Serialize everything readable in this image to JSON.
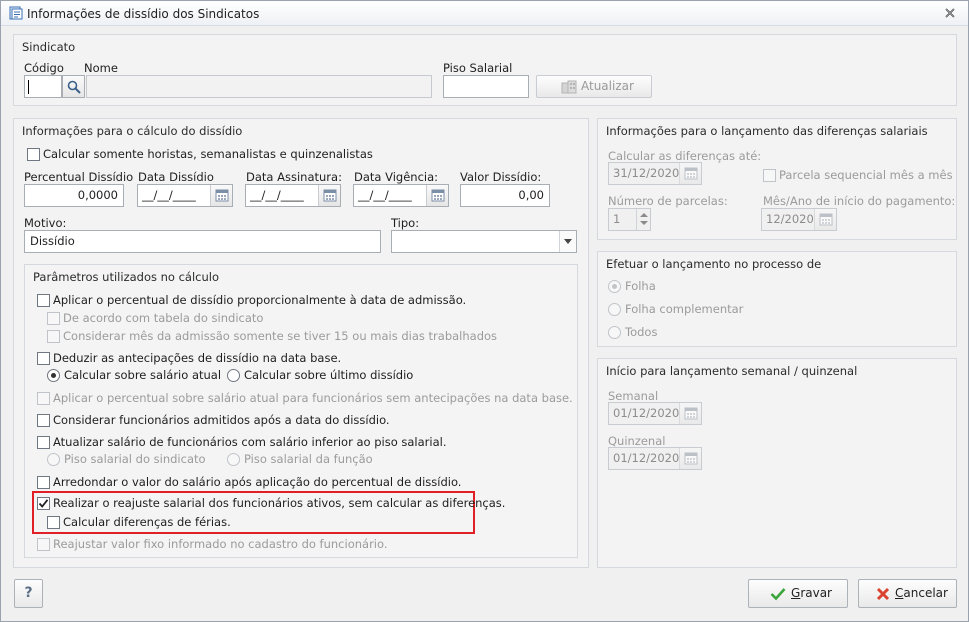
{
  "window": {
    "title": "Informações de dissídio dos Sindicatos"
  },
  "sindicato": {
    "group_title": "Sindicato",
    "codigo_label": "Código",
    "nome_label": "Nome",
    "piso_label": "Piso Salarial",
    "atualizar_label": "Atualizar"
  },
  "calculo": {
    "group_title": "Informações para o cálculo do dissídio",
    "horistas_label": "Calcular somente horistas, semanalistas e quinzenalistas",
    "percentual_label": "Percentual Dissídio",
    "percentual_value": "0,0000",
    "data_dissidio_label": "Data Dissídio",
    "data_dissidio_value": "__/__/____",
    "data_assinatura_label": "Data Assinatura:",
    "data_assinatura_value": "__/__/____",
    "data_vigencia_label": "Data Vigência:",
    "data_vigencia_value": "__/__/____",
    "valor_label": "Valor Dissídio:",
    "valor_value": "0,00",
    "motivo_label": "Motivo:",
    "motivo_value": "Dissídio",
    "tipo_label": "Tipo:",
    "tipo_value": ""
  },
  "parametros": {
    "group_title": "Parâmetros utilizados no cálculo",
    "p1": "Aplicar o percentual de dissídio proporcionalmente à data de admissão.",
    "p1a": "De acordo com tabela do sindicato",
    "p1b": "Considerar mês da admissão somente se tiver 15 ou mais dias trabalhados",
    "p2": "Deduzir as antecipações de dissídio na data base.",
    "p2_radio1": "Calcular sobre salário atual",
    "p2_radio2": "Calcular sobre último dissídio",
    "p3": "Aplicar o percentual sobre salário atual para funcionários sem antecipações na data base.",
    "p4": "Considerar funcionários admitidos após a data do dissídio.",
    "p5": "Atualizar salário de funcionários com salário inferior ao piso salarial.",
    "p5_radio1": "Piso salarial do sindicato",
    "p5_radio2": "Piso salarial da função",
    "p6": "Arredondar o valor do salário após aplicação do percentual de dissídio.",
    "p7": "Realizar o reajuste salarial dos funcionários ativos, sem calcular as diferenças.",
    "p7a": "Calcular diferenças de férias.",
    "p8": "Reajustar valor fixo informado no cadastro do funcionário."
  },
  "lancamento": {
    "group_title": "Informações para o lançamento das diferenças salariais",
    "calcular_ate_label": "Calcular as diferenças até:",
    "calcular_ate_value": "31/12/2020",
    "parcela_label": "Parcela sequencial mês a mês",
    "num_parcelas_label": "Número de parcelas:",
    "num_parcelas_value": "1",
    "mes_ano_label": "Mês/Ano de início do pagamento:",
    "mes_ano_value": "12/2020"
  },
  "processo": {
    "group_title": "Efetuar o lançamento no processo de",
    "folha": "Folha",
    "complementar": "Folha complementar",
    "todos": "Todos"
  },
  "semanal": {
    "group_title": "Início para lançamento semanal / quinzenal",
    "semanal_label": "Semanal",
    "semanal_value": "01/12/2020",
    "quinzenal_label": "Quinzenal",
    "quinzenal_value": "01/12/2020"
  },
  "footer": {
    "help_label": "?",
    "gravar_first": "G",
    "gravar_rest": "ravar",
    "cancelar_first": "C",
    "cancelar_rest": "ancelar"
  },
  "colors": {
    "highlight": "#e01f26",
    "ok_green": "#3aa53a",
    "cancel_red": "#d9432f"
  }
}
